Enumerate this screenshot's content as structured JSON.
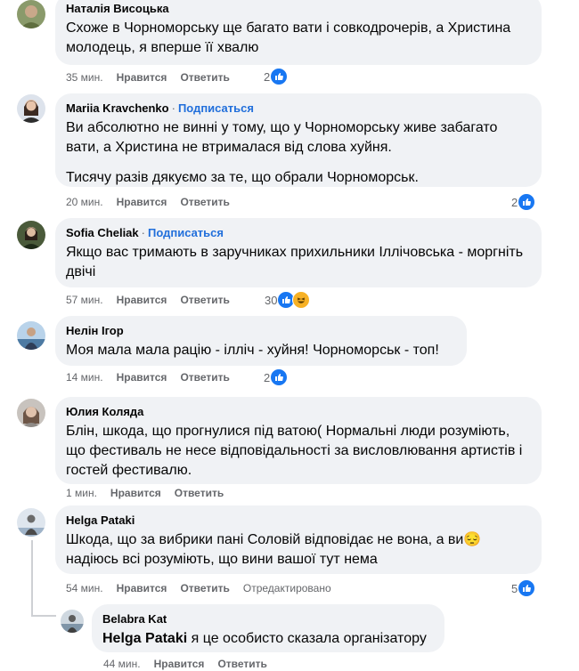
{
  "ui": {
    "like_label": "Нравится",
    "reply_label": "Ответить",
    "follow_label": "Подписаться",
    "like_icon": "like-icon",
    "haha_icon": "haha-icon",
    "accent_color": "#216fdb",
    "bubble_color": "#f0f2f5"
  },
  "comments": [
    {
      "author": "Наталія Висоцька",
      "text": [
        "Схоже в Чорноморську ще багато вати і совкодрочерів, а Христина молодець, я вперше її хвалю"
      ],
      "time": "35 мин.",
      "reactions": "2"
    },
    {
      "author": "Mariia Kravchenko",
      "follow": true,
      "text": [
        "Ви абсолютно не винні у тому, що у Чорноморську живе забагато вати, а Христина не втрималася від слова хуйня.",
        "Тисячу разів дякуємо за те, що обрали Чорноморськ."
      ],
      "time": "20 мин.",
      "reactions": "2"
    },
    {
      "author": "Sofia Cheliak",
      "follow": true,
      "text": [
        "Якщо вас тримають в заручниках прихильники Іллічовська - моргніть двічі"
      ],
      "time": "57 мин.",
      "reactions": "30"
    },
    {
      "author": "Нелін Ігор",
      "text": [
        "Моя мала мала рацію - ілліч - хуйня! Чорноморськ - топ!"
      ],
      "time": "14 мин.",
      "reactions": "2"
    },
    {
      "author": "Юлия Коляда",
      "text": [
        "Блін, шкода, що прогнулися під ватою( Нормальні люди розуміють, що фестиваль не несе відповідальності за висловлювання артистів і гостей фестивалю."
      ],
      "time": "1 мин."
    },
    {
      "author": "Helga Pataki",
      "text": [
        "Шкода, що за вибрики пані Соловій відповідає не вона, а ви😔 надіюсь всі розуміють, що вини вашої тут нема"
      ],
      "time": "54 мин.",
      "edited": "Отредактировано",
      "reactions": "5"
    },
    {
      "author": "Belabra Kat",
      "mention": "Helga Pataki",
      "text": [
        "я це особисто сказала організатору"
      ],
      "time": "44 мин."
    }
  ]
}
